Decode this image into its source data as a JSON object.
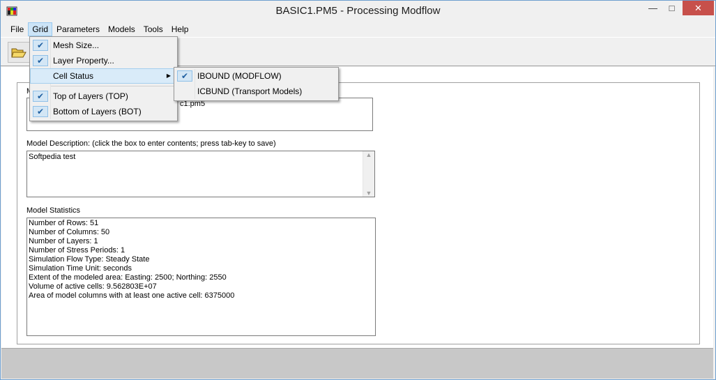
{
  "window": {
    "title": "BASIC1.PM5 - Processing Modflow",
    "minimize_glyph": "—",
    "maximize_glyph": "□",
    "close_glyph": "✕"
  },
  "menubar": {
    "items": [
      "File",
      "Grid",
      "Parameters",
      "Models",
      "Tools",
      "Help"
    ]
  },
  "grid_menu": {
    "items": [
      "Mesh Size...",
      "Layer Property...",
      "Cell Status",
      "Top of Layers (TOP)",
      "Bottom of Layers (BOT)"
    ]
  },
  "cell_status_submenu": {
    "items": [
      "IBOUND (MODFLOW)",
      "ICBUND (Transport Models)"
    ]
  },
  "main": {
    "model_file_label": "M",
    "model_file_value": "c1.pm5",
    "description_label": "Model Description: (click the box to enter contents; press tab-key to save)",
    "description_value": "Softpedia test",
    "statistics_label": "Model Statistics",
    "statistics_lines": [
      "Number of Rows: 51",
      "Number of Columns: 50",
      "Number of Layers: 1",
      "Number of Stress Periods: 1",
      "Simulation Flow Type: Steady State",
      "Simulation Time Unit: seconds",
      "Extent of the modeled area: Easting: 2500; Northing: 2550",
      "Volume of active cells: 9.562803E+07",
      "Area of model columns with at least one active cell: 6375000"
    ]
  },
  "icons": {
    "app": "app-icon",
    "open": "open-folder-icon",
    "check": "check-icon",
    "submenu_arrow": "chevron-right-icon"
  },
  "colors": {
    "menu_highlight": "#cce4f7",
    "close_button": "#c7504b",
    "statusbar": "#c8c8c8"
  }
}
